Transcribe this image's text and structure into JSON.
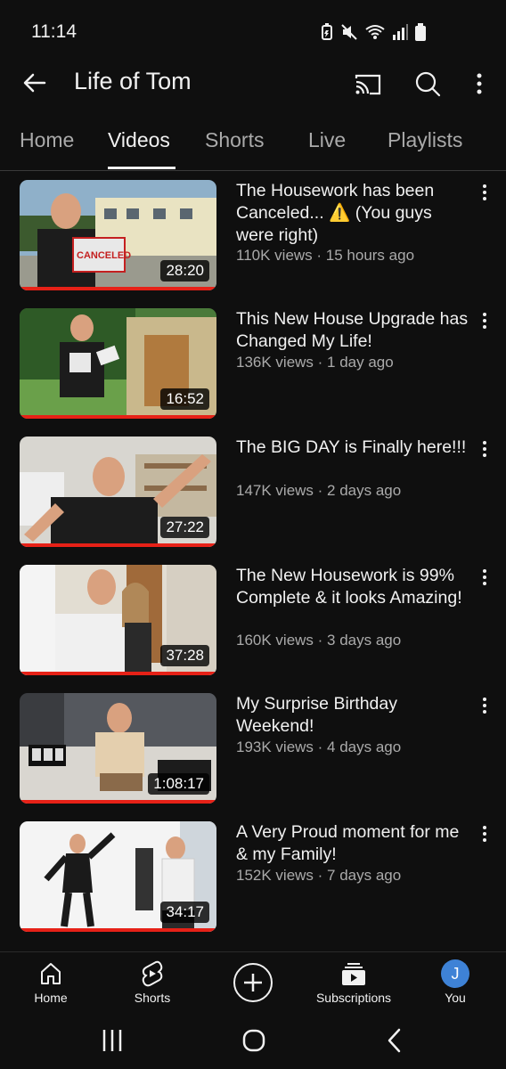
{
  "status": {
    "time": "11:14"
  },
  "header": {
    "title": "Life of Tom"
  },
  "tabs": [
    {
      "label": "Home"
    },
    {
      "label": "Videos",
      "active": true
    },
    {
      "label": "Shorts"
    },
    {
      "label": "Live"
    },
    {
      "label": "Playlists"
    }
  ],
  "videos": [
    {
      "title": "The Housework has been Canceled... ⚠️ (You guys were right)",
      "meta": "110K views · 15 hours ago",
      "duration": "28:20",
      "watched": 1.0
    },
    {
      "title": "This New House Upgrade has Changed My Life!",
      "meta": "136K views · 1 day ago",
      "duration": "16:52",
      "watched": 1.0
    },
    {
      "title": "The BIG DAY is Finally here!!!",
      "meta": "147K views · 2 days ago",
      "duration": "27:22",
      "watched": 1.0
    },
    {
      "title": "The New Housework is 99% Complete & it looks Amazing!",
      "meta": "160K views · 3 days ago",
      "duration": "37:28",
      "watched": 1.0
    },
    {
      "title": "My Surprise Birthday Weekend!",
      "meta": "193K views · 4 days ago",
      "duration": "1:08:17",
      "watched": 1.0
    },
    {
      "title": "A Very Proud moment for me & my Family!",
      "meta": "152K views · 7 days ago",
      "duration": "34:17",
      "watched": 1.0
    }
  ],
  "bottom_nav": {
    "home": "Home",
    "shorts": "Shorts",
    "subscriptions": "Subscriptions",
    "you": "You",
    "avatar_letter": "J"
  },
  "colors": {
    "background": "#0f0f0f",
    "progress": "#e62117",
    "avatar": "#3e82d6"
  }
}
